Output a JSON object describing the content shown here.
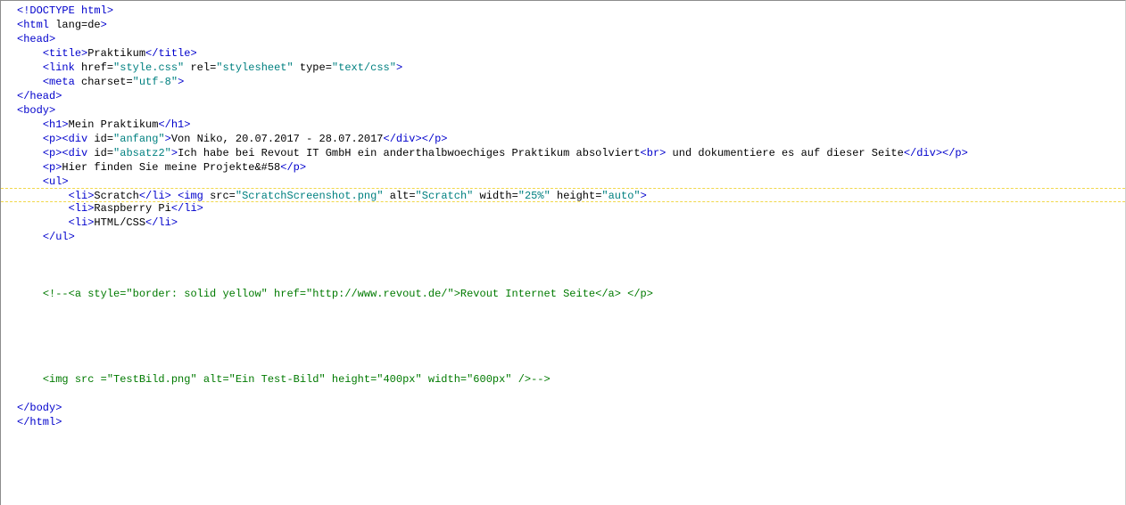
{
  "lines": [
    {
      "segments": [
        {
          "k": "t",
          "v": "<!DOCTYPE html>"
        }
      ]
    },
    {
      "segments": [
        {
          "k": "t",
          "v": "<html"
        },
        {
          "k": "a",
          "v": " lang=de"
        },
        {
          "k": "t",
          "v": ">"
        }
      ]
    },
    {
      "segments": [
        {
          "k": "t",
          "v": "<head>"
        }
      ]
    },
    {
      "segments": [
        {
          "k": "x",
          "v": "    "
        },
        {
          "k": "t",
          "v": "<title>"
        },
        {
          "k": "x",
          "v": "Praktikum"
        },
        {
          "k": "t",
          "v": "</title>"
        }
      ]
    },
    {
      "segments": [
        {
          "k": "x",
          "v": "    "
        },
        {
          "k": "t",
          "v": "<link"
        },
        {
          "k": "a",
          "v": " href="
        },
        {
          "k": "s",
          "v": "\"style.css\""
        },
        {
          "k": "a",
          "v": " rel="
        },
        {
          "k": "s",
          "v": "\"stylesheet\""
        },
        {
          "k": "a",
          "v": " type="
        },
        {
          "k": "s",
          "v": "\"text/css\""
        },
        {
          "k": "t",
          "v": ">"
        }
      ]
    },
    {
      "segments": [
        {
          "k": "x",
          "v": "    "
        },
        {
          "k": "t",
          "v": "<meta"
        },
        {
          "k": "a",
          "v": " charset="
        },
        {
          "k": "s",
          "v": "\"utf-8\""
        },
        {
          "k": "t",
          "v": ">"
        }
      ]
    },
    {
      "segments": [
        {
          "k": "t",
          "v": "</head>"
        }
      ]
    },
    {
      "segments": [
        {
          "k": "t",
          "v": "<body>"
        }
      ]
    },
    {
      "segments": [
        {
          "k": "x",
          "v": "    "
        },
        {
          "k": "t",
          "v": "<h1>"
        },
        {
          "k": "x",
          "v": "Mein Praktikum"
        },
        {
          "k": "t",
          "v": "</h1>"
        }
      ]
    },
    {
      "segments": [
        {
          "k": "x",
          "v": "    "
        },
        {
          "k": "t",
          "v": "<p><div"
        },
        {
          "k": "a",
          "v": " id="
        },
        {
          "k": "s",
          "v": "\"anfang\""
        },
        {
          "k": "t",
          "v": ">"
        },
        {
          "k": "x",
          "v": "Von Niko, 20.07.2017 - 28.07.2017"
        },
        {
          "k": "t",
          "v": "</div></p>"
        }
      ]
    },
    {
      "segments": [
        {
          "k": "x",
          "v": "    "
        },
        {
          "k": "t",
          "v": "<p><div"
        },
        {
          "k": "a",
          "v": " id="
        },
        {
          "k": "s",
          "v": "\"absatz2\""
        },
        {
          "k": "t",
          "v": ">"
        },
        {
          "k": "x",
          "v": "Ich habe bei Revout IT GmbH ein anderthalbwoechiges Praktikum absolviert"
        },
        {
          "k": "t",
          "v": "<br>"
        },
        {
          "k": "x",
          "v": " und dokumentiere es auf dieser Seite"
        },
        {
          "k": "t",
          "v": "</div></p>"
        }
      ]
    },
    {
      "segments": [
        {
          "k": "x",
          "v": "    "
        },
        {
          "k": "t",
          "v": "<p>"
        },
        {
          "k": "x",
          "v": "Hier finden Sie meine Projekte&#58"
        },
        {
          "k": "t",
          "v": "</p>"
        }
      ]
    },
    {
      "segments": [
        {
          "k": "x",
          "v": "    "
        },
        {
          "k": "t",
          "v": "<ul>"
        }
      ]
    },
    {
      "current": true,
      "segments": [
        {
          "k": "x",
          "v": "        "
        },
        {
          "k": "t",
          "v": "<li>"
        },
        {
          "k": "x",
          "v": "Scratch"
        },
        {
          "k": "t",
          "v": "</li>"
        },
        {
          "k": "x",
          "v": " "
        },
        {
          "k": "t",
          "v": "<img"
        },
        {
          "k": "a",
          "v": " src="
        },
        {
          "k": "s",
          "v": "\"ScratchScreenshot.png\""
        },
        {
          "k": "a",
          "v": " alt="
        },
        {
          "k": "s",
          "v": "\"Scratch\""
        },
        {
          "k": "a",
          "v": " width="
        },
        {
          "k": "s",
          "v": "\"25%\""
        },
        {
          "k": "a",
          "v": " height="
        },
        {
          "k": "s",
          "v": "\"auto\""
        },
        {
          "k": "t",
          "v": ">"
        }
      ]
    },
    {
      "segments": [
        {
          "k": "x",
          "v": "        "
        },
        {
          "k": "t",
          "v": "<li>"
        },
        {
          "k": "x",
          "v": "Raspberry Pi"
        },
        {
          "k": "t",
          "v": "</li>"
        }
      ]
    },
    {
      "segments": [
        {
          "k": "x",
          "v": "        "
        },
        {
          "k": "t",
          "v": "<li>"
        },
        {
          "k": "x",
          "v": "HTML/CSS"
        },
        {
          "k": "t",
          "v": "</li>"
        }
      ]
    },
    {
      "segments": [
        {
          "k": "x",
          "v": "    "
        },
        {
          "k": "t",
          "v": "</ul>"
        }
      ]
    },
    {
      "segments": []
    },
    {
      "segments": []
    },
    {
      "segments": []
    },
    {
      "segments": [
        {
          "k": "x",
          "v": "    "
        },
        {
          "k": "c",
          "v": "<!--<a style=\"border: solid yellow\" href=\"http://www.revout.de/\">Revout Internet Seite</a> </p>"
        }
      ]
    },
    {
      "segments": []
    },
    {
      "segments": []
    },
    {
      "segments": []
    },
    {
      "segments": []
    },
    {
      "segments": []
    },
    {
      "segments": [
        {
          "k": "x",
          "v": "    "
        },
        {
          "k": "c",
          "v": "<img src =\"TestBild.png\" alt=\"Ein Test-Bild\" height=\"400px\" width=\"600px\" />-->"
        }
      ]
    },
    {
      "segments": []
    },
    {
      "segments": [
        {
          "k": "t",
          "v": "</body>"
        }
      ]
    },
    {
      "segments": [
        {
          "k": "t",
          "v": "</html>"
        }
      ]
    }
  ]
}
